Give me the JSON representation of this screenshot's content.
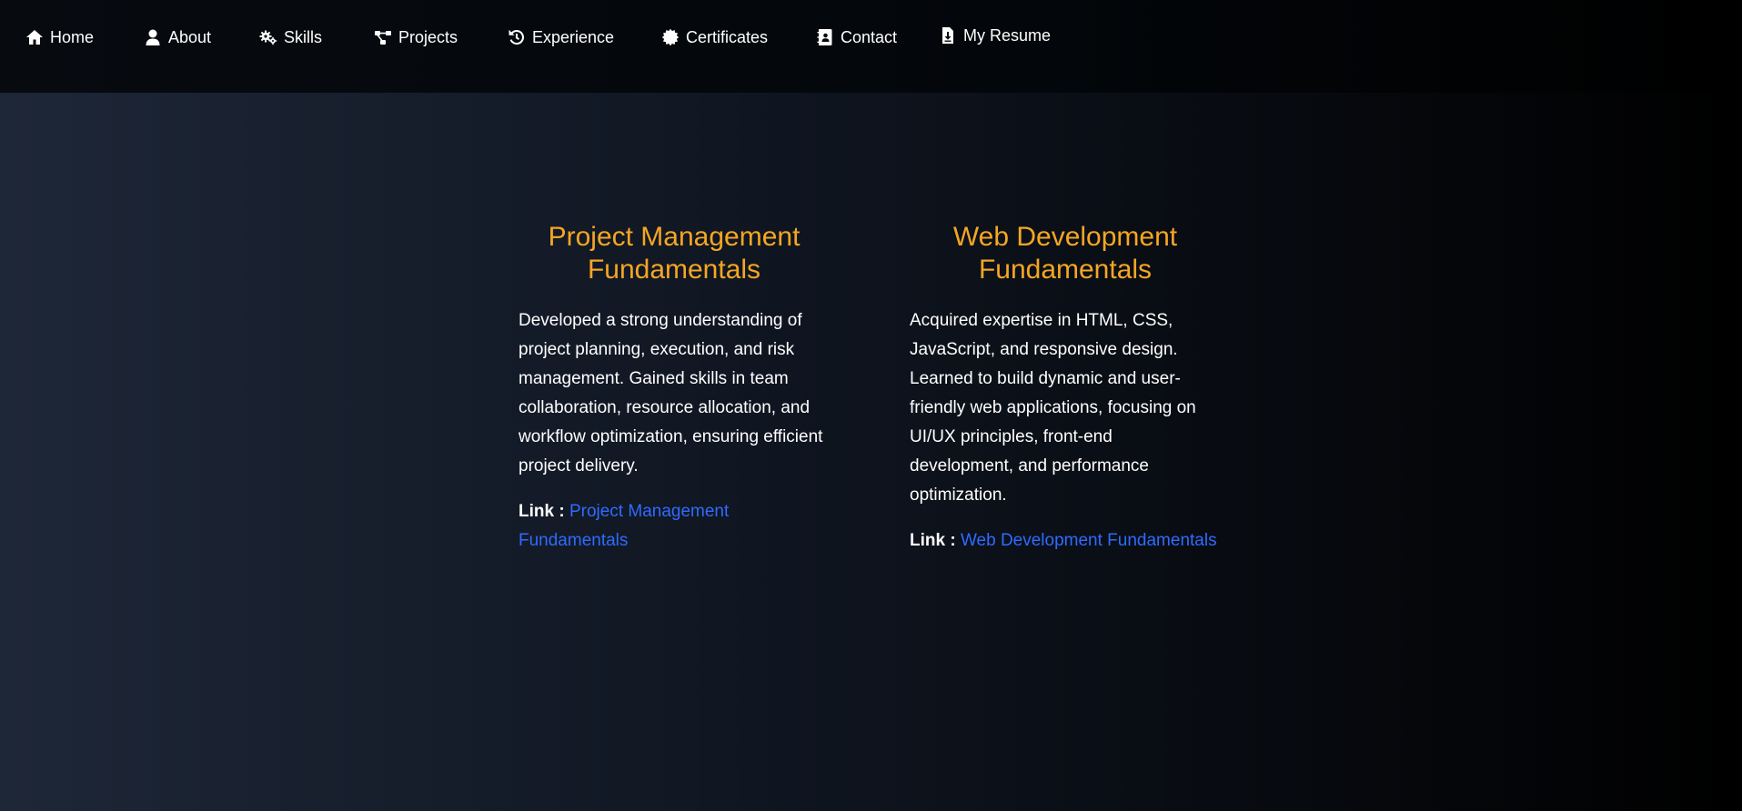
{
  "nav": {
    "items": [
      {
        "label": "Home",
        "icon": "home-icon"
      },
      {
        "label": "About",
        "icon": "user-icon"
      },
      {
        "label": "Skills",
        "icon": "gears-icon"
      },
      {
        "label": "Projects",
        "icon": "diagram-project-icon"
      },
      {
        "label": "Experience",
        "icon": "history-icon"
      },
      {
        "label": "Certificates",
        "icon": "certificate-icon"
      },
      {
        "label": "Contact",
        "icon": "address-book-icon"
      },
      {
        "label": "My Resume",
        "icon": "file-download-icon"
      }
    ]
  },
  "colors": {
    "title_accent": "#f5a623",
    "link": "#2f6bff",
    "text": "#ffffff"
  },
  "certificates": [
    {
      "title": "Project Management Fundamentals",
      "description": "Developed a strong understanding of project planning, execution, and risk management. Gained skills in team collaboration, resource allocation, and workflow optimization, ensuring efficient project delivery.",
      "link_label": "Link :",
      "link_text": "Project Management Fundamentals"
    },
    {
      "title": "Web Development Fundamentals",
      "description": "Acquired expertise in HTML, CSS, JavaScript, and responsive design. Learned to build dynamic and user-friendly web applications, focusing on UI/UX principles, front-end development, and performance optimization.",
      "link_label": "Link :",
      "link_text": "Web Development Fundamentals"
    }
  ]
}
